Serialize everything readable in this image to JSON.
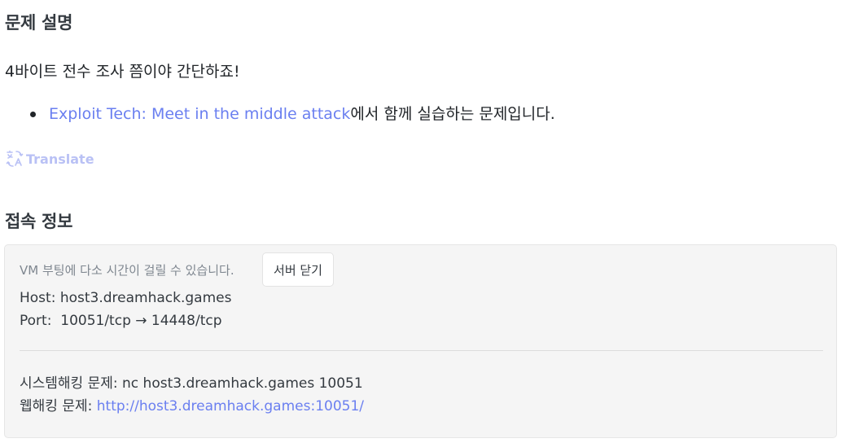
{
  "description_section": {
    "heading": "문제 설명",
    "text": "4바이트 전수 조사 쯤이야 간단하죠!",
    "bullet": {
      "link_text": "Exploit Tech: Meet in the middle attack",
      "suffix": "에서 함께 실습하는 문제입니다."
    },
    "translate": {
      "icon": "translate-icon",
      "label": "Translate"
    }
  },
  "connection_section": {
    "heading": "접속 정보",
    "vm_note": "VM 부팅에 다소 시간이 걸릴 수 있습니다.",
    "close_button_label": "서버 닫기",
    "host": {
      "label": "Host:",
      "value": "host3.dreamhack.games"
    },
    "port": {
      "label": "Port:",
      "value": "10051/tcp → 14448/tcp"
    },
    "system_hacking": {
      "label": "시스템해킹 문제:",
      "command": "nc host3.dreamhack.games 10051"
    },
    "web_hacking": {
      "label": "웹해킹 문제:",
      "url": "http://host3.dreamhack.games:10051/"
    }
  },
  "colors": {
    "link": "#6a7ff0",
    "translate": "#b9c1f5",
    "box_background": "#f5f5f5"
  }
}
